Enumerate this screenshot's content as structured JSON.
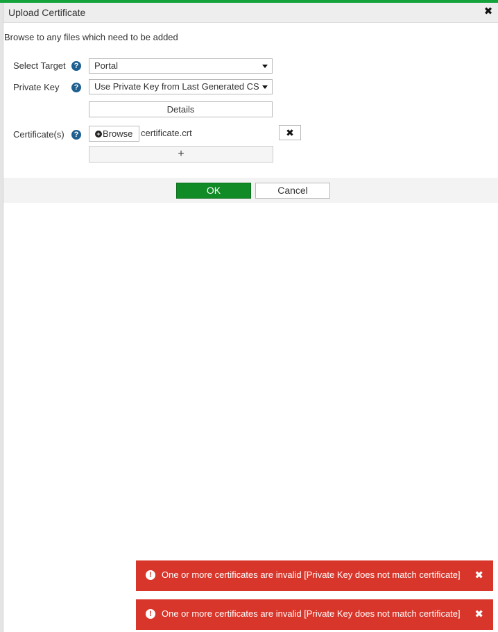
{
  "dialog": {
    "title": "Upload Certificate",
    "close_glyph": "✖",
    "instructions": "Browse to any files which need to be added"
  },
  "form": {
    "select_target": {
      "label": "Select Target",
      "value": "Portal",
      "help_glyph": "?"
    },
    "private_key": {
      "label": "Private Key",
      "value": "Use Private Key from Last Generated CSR",
      "help_glyph": "?"
    },
    "details_label": "Details",
    "certificates": {
      "label": "Certificate(s)",
      "help_glyph": "?",
      "browse_label": "Browse",
      "browse_icon_glyph": "+",
      "file_name": "certificate.crt",
      "remove_glyph": "✖",
      "add_glyph": "+"
    }
  },
  "actions": {
    "ok_label": "OK",
    "cancel_label": "Cancel"
  },
  "notifications": [
    {
      "icon_glyph": "!",
      "message": "One or more certificates are invalid [Private Key does not match certificate]",
      "close_glyph": "✖"
    },
    {
      "icon_glyph": "!",
      "message": "One or more certificates are invalid [Private Key does not match certificate]",
      "close_glyph": "✖"
    }
  ],
  "colors": {
    "accent_top": "#13a33a",
    "ok_button": "#118b26",
    "help_icon": "#1f5f8f",
    "error_toast": "#d9362b"
  },
  "icons": {
    "close": "close-icon",
    "help": "help-icon",
    "dropdown": "caret-down-icon",
    "browse": "plus-circle-icon",
    "remove": "remove-icon",
    "add": "plus-icon",
    "error": "exclamation-circle-icon"
  }
}
